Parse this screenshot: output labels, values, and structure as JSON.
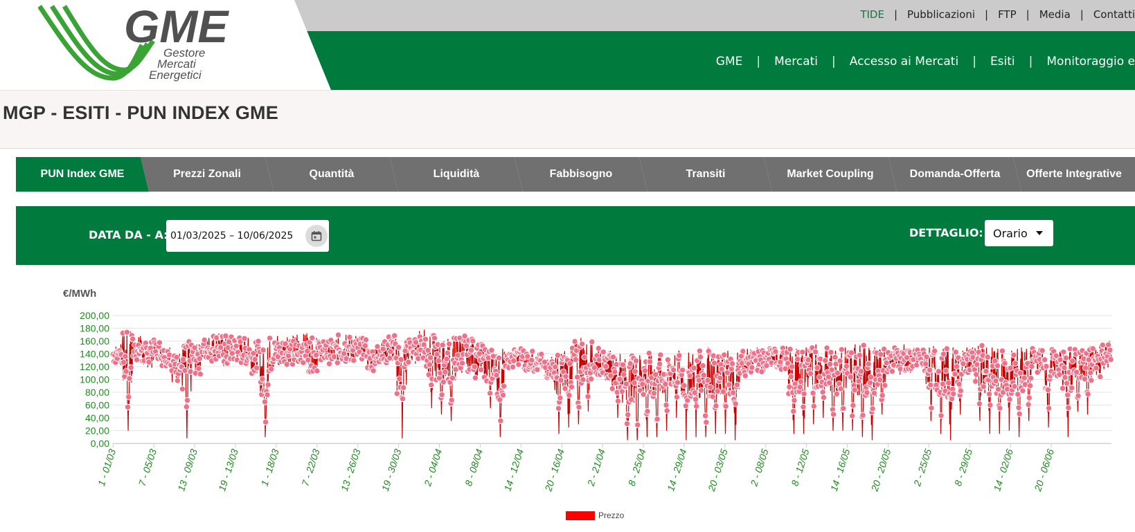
{
  "header": {
    "utility_links": [
      {
        "label": "TIDE",
        "active": true
      },
      {
        "label": "Pubblicazioni",
        "active": false
      },
      {
        "label": "FTP",
        "active": false
      },
      {
        "label": "Media",
        "active": false
      },
      {
        "label": "Contatti",
        "active": false
      }
    ],
    "main_nav": [
      "GME",
      "Mercati",
      "Accesso ai Mercati",
      "Esiti",
      "Monitoraggio e"
    ],
    "logo": {
      "text": "GME",
      "sub1": "Gestore",
      "sub2": "Mercati",
      "sub3": "Energetici"
    }
  },
  "page_title": "MGP - ESITI - PUN INDEX GME",
  "tabs": [
    {
      "label": "PUN Index GME",
      "active": true
    },
    {
      "label": "Prezzi Zonali",
      "active": false
    },
    {
      "label": "Quantità",
      "active": false
    },
    {
      "label": "Liquidità",
      "active": false
    },
    {
      "label": "Fabbisogno",
      "active": false
    },
    {
      "label": "Transiti",
      "active": false
    },
    {
      "label": "Market Coupling",
      "active": false
    },
    {
      "label": "Domanda-Offerta",
      "active": false
    },
    {
      "label": "Offerte Integrative",
      "active": false
    }
  ],
  "filters": {
    "date_label": "DATA DA - A:",
    "date_value": "01/03/2025 – 10/06/2025",
    "calendar_icon": "calendar-icon",
    "detail_label": "DETTAGLIO:",
    "detail_value": "Orario"
  },
  "colors": {
    "brand_green": "#007a3d",
    "tab_gray": "#707070",
    "point_fill": "#f0708a",
    "line_red": "#d00000",
    "tick_green": "#1d8a1d"
  },
  "chart_data": {
    "type": "line",
    "ylabel": "€/MWh",
    "ylim": [
      0,
      200
    ],
    "yticks": [
      "0,00",
      "20,00",
      "40,00",
      "60,00",
      "80,00",
      "100,00",
      "120,00",
      "140,00",
      "160,00",
      "180,00",
      "200,00"
    ],
    "x_start": "01/03",
    "x_end": "10/06",
    "xticks": [
      "1 - 01/03",
      "7 - 05/03",
      "13 - 09/03",
      "19 - 13/03",
      "1 - 18/03",
      "7 - 22/03",
      "13 - 26/03",
      "19 - 30/03",
      "2 - 04/04",
      "8 - 08/04",
      "14 - 12/04",
      "20 - 16/04",
      "2 - 21/04",
      "8 - 25/04",
      "14 - 29/04",
      "20 - 03/05",
      "2 - 08/05",
      "8 - 12/05",
      "14 - 16/05",
      "20 - 20/05",
      "2 - 25/05",
      "8 - 29/05",
      "14 - 02/06",
      "20 - 06/06"
    ],
    "grid": true,
    "legend": "bottom-center",
    "series": [
      {
        "name": "Prezzo",
        "color": "#ff0000",
        "x": [
          "01/03",
          "02/03",
          "03/03",
          "04/03",
          "05/03",
          "06/03",
          "07/03",
          "08/03",
          "09/03",
          "10/03",
          "11/03",
          "12/03",
          "13/03",
          "14/03",
          "15/03",
          "16/03",
          "17/03",
          "18/03",
          "19/03",
          "20/03",
          "21/03",
          "22/03",
          "23/03",
          "24/03",
          "25/03",
          "26/03",
          "27/03",
          "28/03",
          "29/03",
          "30/03",
          "31/03",
          "01/04",
          "02/04",
          "03/04",
          "04/04",
          "05/04",
          "06/04",
          "07/04",
          "08/04",
          "09/04",
          "10/04",
          "11/04",
          "12/04",
          "13/04",
          "14/04",
          "15/04",
          "16/04",
          "17/04",
          "18/04",
          "19/04",
          "20/04",
          "21/04",
          "22/04",
          "23/04",
          "24/04",
          "25/04",
          "26/04",
          "27/04",
          "28/04",
          "29/04",
          "30/04",
          "01/05",
          "02/05",
          "03/05",
          "04/05",
          "05/05",
          "06/05",
          "07/05",
          "08/05",
          "09/05",
          "10/05",
          "11/05",
          "12/05",
          "13/05",
          "14/05",
          "15/05",
          "16/05",
          "17/05",
          "18/05",
          "19/05",
          "20/05",
          "21/05",
          "22/05",
          "23/05",
          "24/05",
          "25/05",
          "26/05",
          "27/05",
          "28/05",
          "29/05",
          "30/05",
          "31/05",
          "01/06",
          "02/06",
          "03/06",
          "04/06",
          "05/06",
          "06/06",
          "07/06",
          "08/06",
          "09/06",
          "10/06"
        ],
        "daily_max": [
          155,
          175,
          168,
          160,
          162,
          150,
          140,
          160,
          155,
          165,
          172,
          170,
          168,
          165,
          160,
          150,
          168,
          166,
          170,
          172,
          165,
          160,
          162,
          170,
          168,
          165,
          150,
          160,
          170,
          162,
          165,
          178,
          170,
          160,
          168,
          172,
          165,
          155,
          150,
          148,
          142,
          150,
          145,
          140,
          135,
          140,
          150,
          165,
          160,
          150,
          145,
          140,
          135,
          138,
          142,
          140,
          135,
          145,
          142,
          145,
          150,
          140,
          145,
          142,
          148,
          150,
          145,
          150,
          152,
          148,
          150,
          155,
          150,
          145,
          150,
          155,
          158,
          150,
          148,
          150,
          155,
          150,
          148,
          152,
          148,
          150,
          145,
          150,
          155,
          150,
          148,
          145,
          150,
          152,
          148,
          150,
          145,
          150,
          148,
          152,
          155,
          160
        ],
        "daily_min": [
          100,
          20,
          95,
          85,
          100,
          95,
          60,
          8,
          70,
          100,
          90,
          75,
          95,
          90,
          70,
          10,
          60,
          90,
          80,
          90,
          70,
          100,
          95,
          90,
          90,
          100,
          85,
          95,
          90,
          8,
          90,
          95,
          55,
          45,
          35,
          60,
          70,
          60,
          55,
          10,
          95,
          95,
          90,
          85,
          75,
          15,
          25,
          30,
          50,
          70,
          60,
          40,
          5,
          5,
          10,
          10,
          20,
          40,
          5,
          10,
          10,
          15,
          15,
          5,
          70,
          80,
          85,
          90,
          80,
          15,
          15,
          30,
          40,
          20,
          20,
          20,
          10,
          5,
          45,
          80,
          70,
          75,
          80,
          35,
          15,
          5,
          45,
          80,
          35,
          15,
          15,
          20,
          10,
          35,
          80,
          25,
          70,
          10,
          50,
          45,
          60,
          80
        ]
      }
    ]
  }
}
